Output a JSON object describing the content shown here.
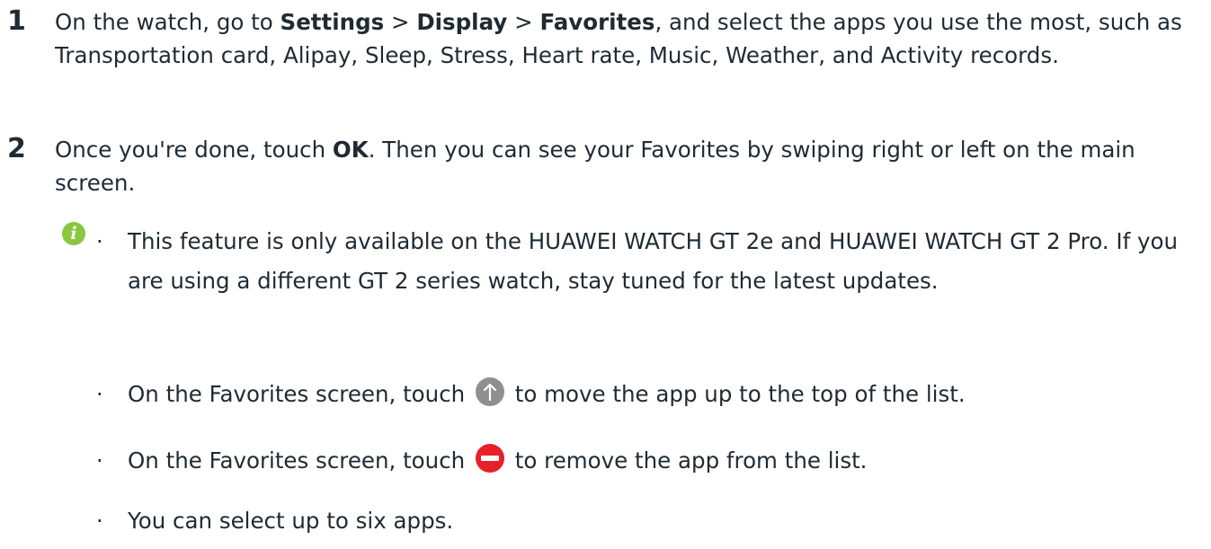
{
  "steps": [
    {
      "number": "1",
      "p1": "On the watch, go to ",
      "settings": "Settings",
      "sep1": " > ",
      "display": "Display",
      "sep2": " > ",
      "favorites": "Favorites",
      "p2": ", and select the apps you use the most, such as Transportation card, Alipay, Sleep, Stress, Heart rate, Music, Weather, and Activity records."
    },
    {
      "number": "2",
      "p1": "Once you're done, touch ",
      "ok": "OK",
      "p2": ". Then you can see your Favorites by swiping right or left on the main screen."
    }
  ],
  "note": {
    "icon_glyph": "i",
    "icon_name": "info-icon",
    "bullet_glyph": "·",
    "items": [
      {
        "text": "This feature is only available on the HUAWEI WATCH GT 2e and HUAWEI WATCH GT 2 Pro. If you are using a different GT 2 series watch, stay tuned for the latest updates."
      },
      {
        "before": "On the Favorites screen, touch",
        "icon": "move-up-icon",
        "after": "to move the app up to the top of the list."
      },
      {
        "before": "On the Favorites screen, touch",
        "icon": "remove-icon",
        "after": "to remove the app from the list."
      },
      {
        "text": "You can select up to six apps."
      }
    ]
  },
  "colors": {
    "info_icon": "#8ac63f",
    "move_up_icon": "#8f8f8f",
    "remove_icon": "#e8202a",
    "text": "#1f2a33"
  }
}
